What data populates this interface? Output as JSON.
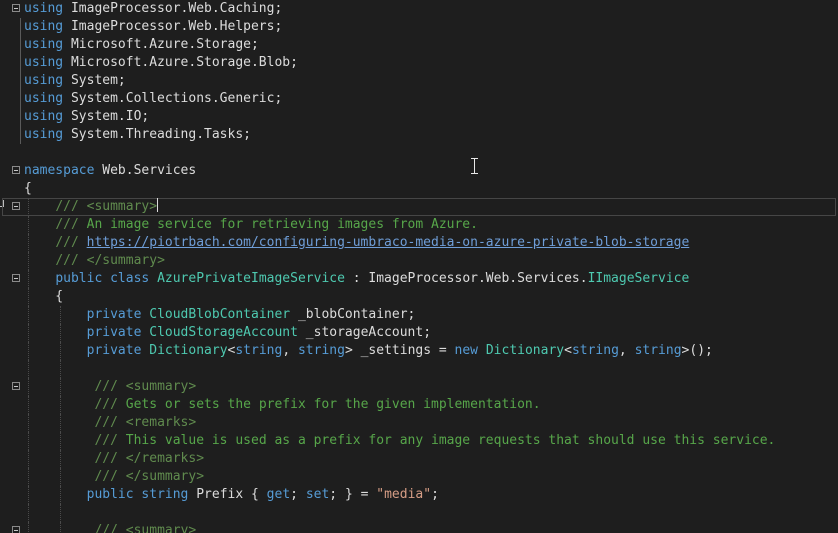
{
  "editor": {
    "lines": [
      {
        "fold": true,
        "tokens": [
          [
            "kw",
            "using"
          ],
          [
            "plain",
            " ImageProcessor.Web.Caching;"
          ]
        ]
      },
      {
        "fold": false,
        "tokens": [
          [
            "kw",
            "using"
          ],
          [
            "plain",
            " ImageProcessor.Web.Helpers;"
          ]
        ]
      },
      {
        "fold": false,
        "tokens": [
          [
            "kw",
            "using"
          ],
          [
            "plain",
            " Microsoft.Azure.Storage;"
          ]
        ]
      },
      {
        "fold": false,
        "tokens": [
          [
            "kw",
            "using"
          ],
          [
            "plain",
            " Microsoft.Azure.Storage.Blob;"
          ]
        ]
      },
      {
        "fold": false,
        "tokens": [
          [
            "kw",
            "using"
          ],
          [
            "plain",
            " System;"
          ]
        ]
      },
      {
        "fold": false,
        "tokens": [
          [
            "kw",
            "using"
          ],
          [
            "plain",
            " System.Collections.Generic;"
          ]
        ]
      },
      {
        "fold": false,
        "tokens": [
          [
            "kw",
            "using"
          ],
          [
            "plain",
            " System.IO;"
          ]
        ]
      },
      {
        "fold": false,
        "tokens": [
          [
            "kw",
            "using"
          ],
          [
            "plain",
            " System.Threading.Tasks;"
          ]
        ]
      },
      {
        "fold": false,
        "tokens": []
      },
      {
        "fold": true,
        "tokens": [
          [
            "kw",
            "namespace"
          ],
          [
            "plain",
            " Web.Services"
          ]
        ]
      },
      {
        "fold": false,
        "tokens": [
          [
            "plain",
            "{"
          ]
        ]
      },
      {
        "fold": true,
        "current": true,
        "tokens": [
          [
            "plain",
            "    "
          ],
          [
            "doctag",
            "///"
          ],
          [
            "plain",
            " "
          ],
          [
            "doctag",
            "<summary>"
          ],
          [
            "caret",
            ""
          ]
        ]
      },
      {
        "fold": false,
        "tokens": [
          [
            "plain",
            "    "
          ],
          [
            "doctag",
            "///"
          ],
          [
            "comment",
            " An image service for retrieving images from Azure."
          ]
        ]
      },
      {
        "fold": false,
        "tokens": [
          [
            "plain",
            "    "
          ],
          [
            "doctag",
            "///"
          ],
          [
            "plain",
            " "
          ],
          [
            "link",
            "https://piotrbach.com/configuring-umbraco-media-on-azure-private-blob-storage"
          ]
        ]
      },
      {
        "fold": false,
        "tokens": [
          [
            "plain",
            "    "
          ],
          [
            "doctag",
            "///"
          ],
          [
            "plain",
            " "
          ],
          [
            "doctag",
            "</summary>"
          ]
        ]
      },
      {
        "fold": true,
        "tokens": [
          [
            "plain",
            "    "
          ],
          [
            "kw",
            "public"
          ],
          [
            "plain",
            " "
          ],
          [
            "kw",
            "class"
          ],
          [
            "plain",
            " "
          ],
          [
            "type",
            "AzurePrivateImageService"
          ],
          [
            "plain",
            " : ImageProcessor.Web.Services."
          ],
          [
            "type",
            "IImageService"
          ]
        ]
      },
      {
        "fold": false,
        "tokens": [
          [
            "plain",
            "    {"
          ]
        ]
      },
      {
        "fold": false,
        "tokens": [
          [
            "plain",
            "        "
          ],
          [
            "kw",
            "private"
          ],
          [
            "plain",
            " "
          ],
          [
            "type",
            "CloudBlobContainer"
          ],
          [
            "plain",
            " _blobContainer;"
          ]
        ]
      },
      {
        "fold": false,
        "tokens": [
          [
            "plain",
            "        "
          ],
          [
            "kw",
            "private"
          ],
          [
            "plain",
            " "
          ],
          [
            "type",
            "CloudStorageAccount"
          ],
          [
            "plain",
            " _storageAccount;"
          ]
        ]
      },
      {
        "fold": false,
        "tokens": [
          [
            "plain",
            "        "
          ],
          [
            "kw",
            "private"
          ],
          [
            "plain",
            " "
          ],
          [
            "type",
            "Dictionary"
          ],
          [
            "plain",
            "<"
          ],
          [
            "kw",
            "string"
          ],
          [
            "plain",
            ", "
          ],
          [
            "kw",
            "string"
          ],
          [
            "plain",
            "> _settings = "
          ],
          [
            "kw",
            "new"
          ],
          [
            "plain",
            " "
          ],
          [
            "type",
            "Dictionary"
          ],
          [
            "plain",
            "<"
          ],
          [
            "kw",
            "string"
          ],
          [
            "plain",
            ", "
          ],
          [
            "kw",
            "string"
          ],
          [
            "plain",
            ">();"
          ]
        ]
      },
      {
        "fold": false,
        "tokens": []
      },
      {
        "fold": true,
        "tokens": [
          [
            "plain",
            "         "
          ],
          [
            "doctag",
            "///"
          ],
          [
            "plain",
            " "
          ],
          [
            "doctag",
            "<summary>"
          ]
        ]
      },
      {
        "fold": false,
        "tokens": [
          [
            "plain",
            "         "
          ],
          [
            "doctag",
            "///"
          ],
          [
            "comment",
            " Gets or sets the prefix for the given implementation."
          ]
        ]
      },
      {
        "fold": false,
        "tokens": [
          [
            "plain",
            "         "
          ],
          [
            "doctag",
            "///"
          ],
          [
            "plain",
            " "
          ],
          [
            "doctag",
            "<remarks>"
          ]
        ]
      },
      {
        "fold": false,
        "tokens": [
          [
            "plain",
            "         "
          ],
          [
            "doctag",
            "///"
          ],
          [
            "comment",
            " This value is used as a prefix for any image requests that should use this service."
          ]
        ]
      },
      {
        "fold": false,
        "tokens": [
          [
            "plain",
            "         "
          ],
          [
            "doctag",
            "///"
          ],
          [
            "plain",
            " "
          ],
          [
            "doctag",
            "</remarks>"
          ]
        ]
      },
      {
        "fold": false,
        "tokens": [
          [
            "plain",
            "         "
          ],
          [
            "doctag",
            "///"
          ],
          [
            "plain",
            " "
          ],
          [
            "doctag",
            "</summary>"
          ]
        ]
      },
      {
        "fold": false,
        "tokens": [
          [
            "plain",
            "        "
          ],
          [
            "kw",
            "public"
          ],
          [
            "plain",
            " "
          ],
          [
            "kw",
            "string"
          ],
          [
            "plain",
            " Prefix { "
          ],
          [
            "kw",
            "get"
          ],
          [
            "plain",
            "; "
          ],
          [
            "kw",
            "set"
          ],
          [
            "plain",
            "; } = "
          ],
          [
            "str",
            "\"media\""
          ],
          [
            "plain",
            ";"
          ]
        ]
      },
      {
        "fold": false,
        "tokens": []
      },
      {
        "fold": true,
        "tokens": [
          [
            "plain",
            "         "
          ],
          [
            "doctag",
            "///"
          ],
          [
            "plain",
            " "
          ],
          [
            "doctag",
            "<summary>"
          ]
        ]
      }
    ]
  }
}
